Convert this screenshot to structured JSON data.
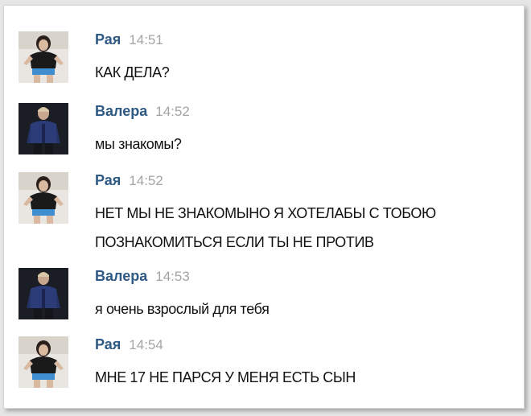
{
  "messages": [
    {
      "author": "Рая",
      "time": "14:51",
      "lines": [
        "КАК ДЕЛА?"
      ],
      "avatar": "girl-avatar"
    },
    {
      "author": "Валера",
      "time": "14:52",
      "lines": [
        "мы знакомы?"
      ],
      "avatar": "guy-avatar"
    },
    {
      "author": "Рая",
      "time": "14:52",
      "lines": [
        "НЕТ МЫ НЕ ЗНАКОМЫНО Я ХОТЕЛАБЫ С ТОБОЮ",
        "ПОЗНАКОМИТЬСЯ ЕСЛИ ТЫ НЕ ПРОТИВ"
      ],
      "avatar": "girl-avatar"
    },
    {
      "author": "Валера",
      "time": "14:53",
      "lines": [
        "я очень взрослый для тебя"
      ],
      "avatar": "guy-avatar"
    },
    {
      "author": "Рая",
      "time": "14:54",
      "lines": [
        "МНЕ 17 НЕ ПАРСЯ У МЕНЯ ЕСТЬ СЫН"
      ],
      "avatar": "girl-avatar"
    }
  ],
  "colors": {
    "author_name": "#2f5a84",
    "timestamp": "#a4a4a4",
    "message_text": "#111111"
  }
}
